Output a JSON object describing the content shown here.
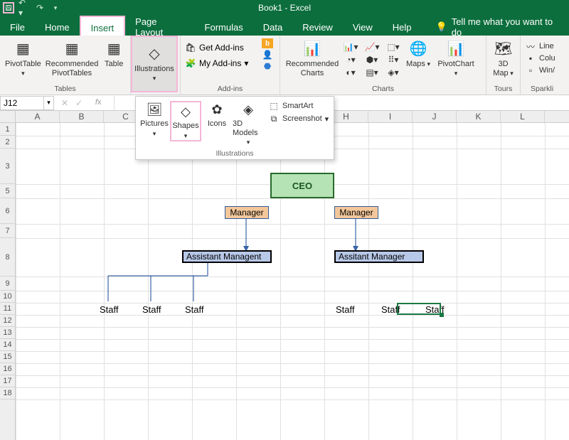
{
  "title": "Book1  -  Excel",
  "qat": {
    "save": "save",
    "undo": "undo",
    "redo": "redo",
    "more": "more"
  },
  "tabs": {
    "file": "File",
    "home": "Home",
    "insert": "Insert",
    "pageLayout": "Page Layout",
    "formulas": "Formulas",
    "data": "Data",
    "review": "Review",
    "view": "View",
    "help": "Help",
    "tellme": "Tell me what you want to do"
  },
  "ribbon": {
    "tables": {
      "pivot": "PivotTable",
      "recommendedPivot": "Recommended PivotTables",
      "table": "Table",
      "label": "Tables"
    },
    "illustrations": {
      "btn": "Illustrations"
    },
    "addins": {
      "get": "Get Add-ins",
      "my": "My Add-ins",
      "label": "Add-ins"
    },
    "charts": {
      "recommended": "Recommended Charts",
      "maps": "Maps",
      "pivotchart": "PivotChart",
      "label": "Charts"
    },
    "tours": {
      "map3d": "3D Map",
      "label": "Tours"
    },
    "spark": {
      "line": "Line",
      "column": "Colu",
      "winloss": "Win/",
      "label": "Sparkli"
    }
  },
  "ill_panel": {
    "pictures": "Pictures",
    "shapes": "Shapes",
    "icons": "Icons",
    "models": "3D Models",
    "smartart": "SmartArt",
    "screenshot": "Screenshot",
    "label": "Illustrations"
  },
  "namebox": "J12",
  "columns": [
    "A",
    "B",
    "C",
    "D",
    "E",
    "F",
    "G",
    "H",
    "I",
    "J",
    "K",
    "L"
  ],
  "rows": [
    "1",
    "2",
    "3",
    "5",
    "6",
    "7",
    "8",
    "9",
    "10",
    "11",
    "12",
    "13",
    "14",
    "15",
    "16",
    "17",
    "18"
  ],
  "org": {
    "ceo": "CEO",
    "mgr1": "Manager",
    "mgr2": "Manager",
    "am1": "Assistant Managent",
    "am2": "Assitant Manager",
    "staff1": "Staff",
    "staff2": "Staff",
    "staff3": "Staff",
    "staff4": "Staff",
    "staff5": "Staff",
    "staff6": "Staff"
  },
  "selected_cell": "J12"
}
